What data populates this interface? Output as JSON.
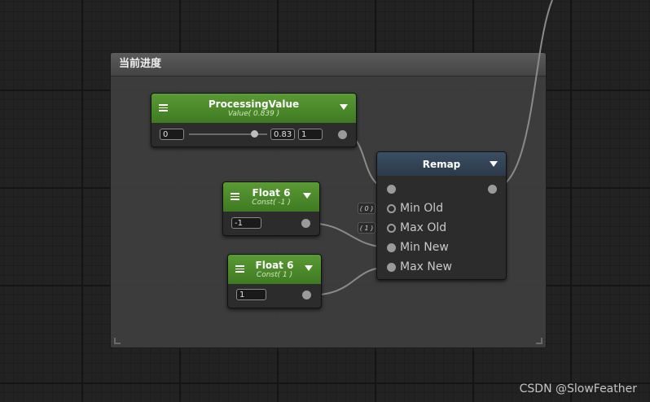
{
  "group": {
    "title": "当前进度"
  },
  "processing_node": {
    "title": "ProcessingValue",
    "subtitle": "Value( 0.839 )",
    "min_value": "0",
    "slider_fraction": 0.839,
    "current_value": "0.83",
    "max_value": "1"
  },
  "float_node_a": {
    "title": "Float 6",
    "subtitle": "Const( -1 )",
    "value": "-1"
  },
  "float_node_b": {
    "title": "Float 6",
    "subtitle": "Const( 1 )",
    "value": "1"
  },
  "remap_node": {
    "title": "Remap",
    "inputs": [
      "Min Old",
      "Max Old",
      "Min New",
      "Max New"
    ],
    "defaults": {
      "min_old": "( 0 )",
      "max_old": "( 1 )"
    }
  },
  "colors": {
    "graph_background": "#222222",
    "node_header_green": "#4f8a2c",
    "node_header_blue": "#334456",
    "port": "#9a9a9a",
    "wire": "#8a8a8a"
  },
  "watermark": "CSDN @SlowFeather"
}
